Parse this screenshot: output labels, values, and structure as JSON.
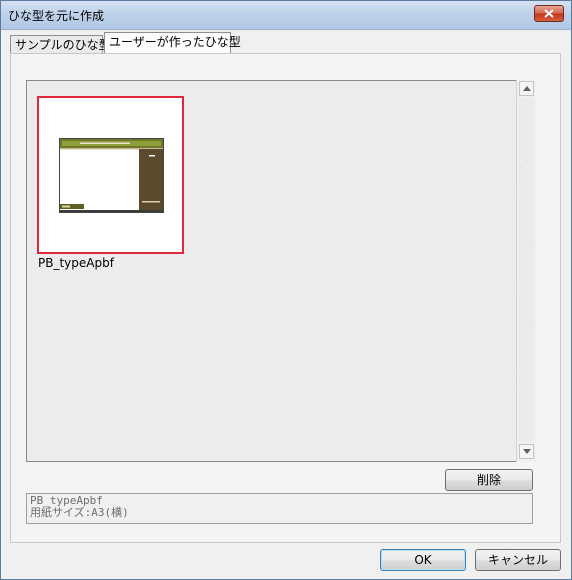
{
  "window": {
    "title": "ひな型を元に作成"
  },
  "tabs": [
    {
      "label": "サンプルのひな型",
      "selected": false
    },
    {
      "label": "ユーザーが作ったひな型",
      "selected": true
    }
  ],
  "templates": [
    {
      "name": "PB_typeApbf",
      "selected": true
    }
  ],
  "buttons": {
    "delete": "削除",
    "ok": "OK",
    "cancel": "キャンセル"
  },
  "description": {
    "line1": "PB_typeApbf",
    "line2": "用紙サイズ:A3(横)"
  },
  "colors": {
    "selection_border": "#e0273b",
    "thumb_accent": "#5a4b2c",
    "thumb_green": "#8a9a2a"
  }
}
